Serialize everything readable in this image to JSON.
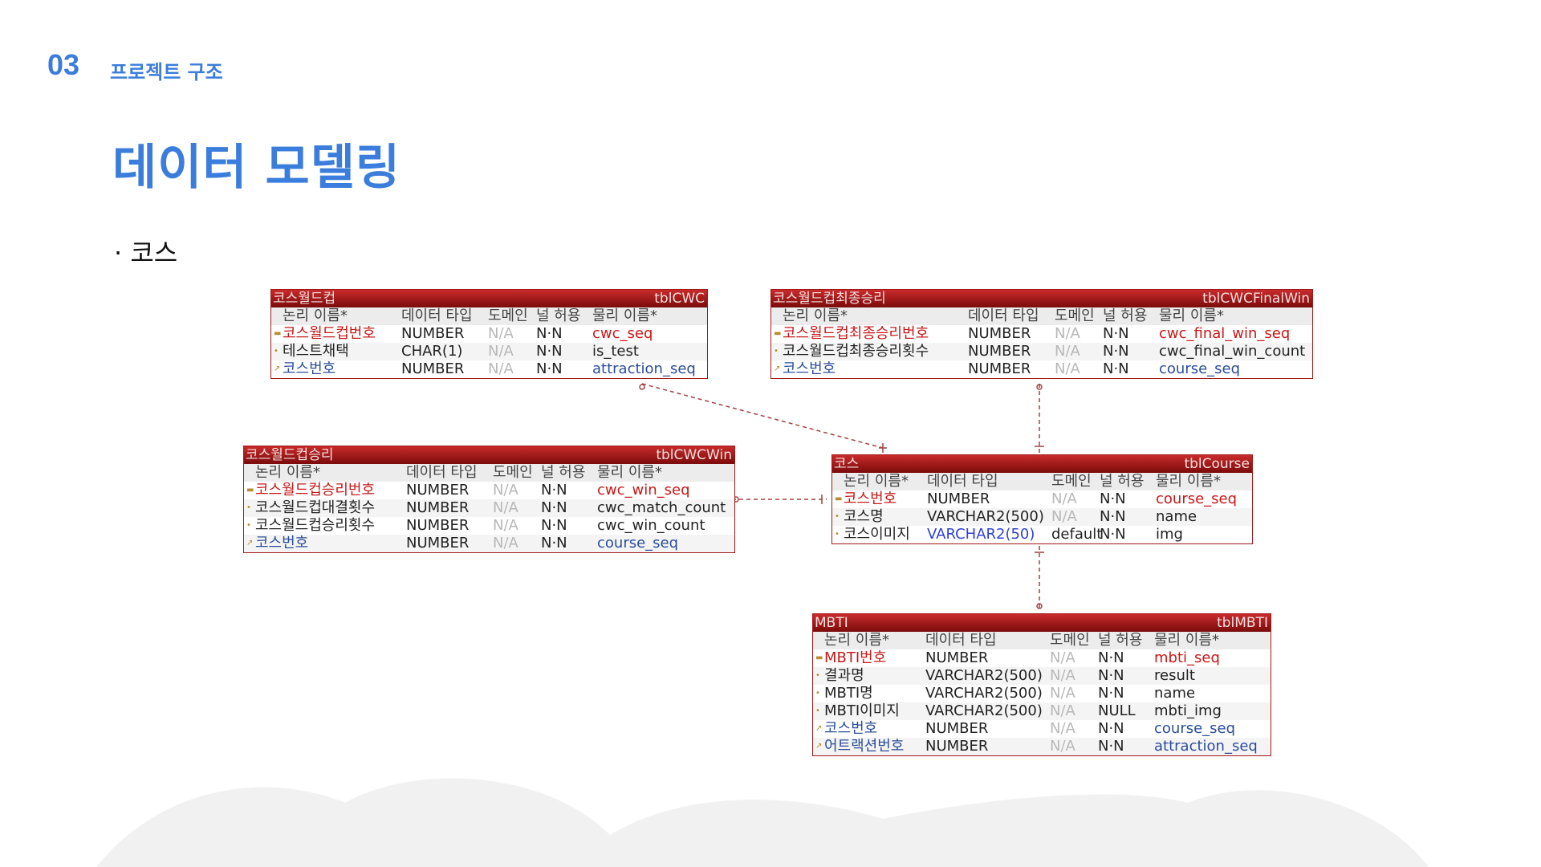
{
  "header": {
    "number": "03",
    "subtitle": "프로젝트 구조"
  },
  "title": "데이터 모델링",
  "bullet": "· 코스",
  "columns": {
    "logical": "논리 이름*",
    "datatype": "데이터 타입",
    "domain": "도메인",
    "null": "널 허용",
    "physical": "물리 이름*"
  },
  "entities": {
    "cwc": {
      "logical_name": "코스월드컵",
      "physical_name": "tblCWC",
      "rows": [
        {
          "logical": "코스월드컵번호",
          "type": "NUMBER",
          "domain": "N/A",
          "null": "N·N",
          "physical": "cwc_seq",
          "key": "pk"
        },
        {
          "logical": "테스트채택",
          "type": "CHAR(1)",
          "domain": "N/A",
          "null": "N·N",
          "physical": "is_test",
          "key": ""
        },
        {
          "logical": "코스번호",
          "type": "NUMBER",
          "domain": "N/A",
          "null": "N·N",
          "physical": "attraction_seq",
          "key": "fk"
        }
      ]
    },
    "cwcfinal": {
      "logical_name": "코스월드컵최종승리",
      "physical_name": "tblCWCFinalWin",
      "rows": [
        {
          "logical": "코스월드컵최종승리번호",
          "type": "NUMBER",
          "domain": "N/A",
          "null": "N·N",
          "physical": "cwc_final_win_seq",
          "key": "pk"
        },
        {
          "logical": "코스월드컵최종승리횟수",
          "type": "NUMBER",
          "domain": "N/A",
          "null": "N·N",
          "physical": "cwc_final_win_count",
          "key": ""
        },
        {
          "logical": "코스번호",
          "type": "NUMBER",
          "domain": "N/A",
          "null": "N·N",
          "physical": "course_seq",
          "key": "fk"
        }
      ]
    },
    "cwcwin": {
      "logical_name": "코스월드컵승리",
      "physical_name": "tblCWCWin",
      "rows": [
        {
          "logical": "코스월드컵승리번호",
          "type": "NUMBER",
          "domain": "N/A",
          "null": "N·N",
          "physical": "cwc_win_seq",
          "key": "pk"
        },
        {
          "logical": "코스월드컵대결횟수",
          "type": "NUMBER",
          "domain": "N/A",
          "null": "N·N",
          "physical": "cwc_match_count",
          "key": ""
        },
        {
          "logical": "코스월드컵승리횟수",
          "type": "NUMBER",
          "domain": "N/A",
          "null": "N·N",
          "physical": "cwc_win_count",
          "key": ""
        },
        {
          "logical": "코스번호",
          "type": "NUMBER",
          "domain": "N/A",
          "null": "N·N",
          "physical": "course_seq",
          "key": "fk"
        }
      ]
    },
    "course": {
      "logical_name": "코스",
      "physical_name": "tblCourse",
      "rows": [
        {
          "logical": "코스번호",
          "type": "NUMBER",
          "domain": "N/A",
          "null": "N·N",
          "physical": "course_seq",
          "key": "pk"
        },
        {
          "logical": "코스명",
          "type": "VARCHAR2(500)",
          "domain": "N/A",
          "null": "N·N",
          "physical": "name",
          "key": ""
        },
        {
          "logical": "코스이미지",
          "type": "VARCHAR2(50)",
          "domain": "default",
          "null": "N·N",
          "physical": "img",
          "key": "",
          "type_color": "blue"
        }
      ]
    },
    "mbti": {
      "logical_name": "MBTI",
      "physical_name": "tblMBTI",
      "rows": [
        {
          "logical": "MBTI번호",
          "type": "NUMBER",
          "domain": "N/A",
          "null": "N·N",
          "physical": "mbti_seq",
          "key": "pk"
        },
        {
          "logical": "결과명",
          "type": "VARCHAR2(500)",
          "domain": "N/A",
          "null": "N·N",
          "physical": "result",
          "key": ""
        },
        {
          "logical": "MBTI명",
          "type": "VARCHAR2(500)",
          "domain": "N/A",
          "null": "N·N",
          "physical": "name",
          "key": ""
        },
        {
          "logical": "MBTI이미지",
          "type": "VARCHAR2(500)",
          "domain": "N/A",
          "null": "NULL",
          "physical": "mbti_img",
          "key": ""
        },
        {
          "logical": "코스번호",
          "type": "NUMBER",
          "domain": "N/A",
          "null": "N·N",
          "physical": "course_seq",
          "key": "fk"
        },
        {
          "logical": "어트랙션번호",
          "type": "NUMBER",
          "domain": "N/A",
          "null": "N·N",
          "physical": "attraction_seq",
          "key": "fk"
        }
      ]
    }
  },
  "colors": {
    "accent": "#3b7ddd",
    "entity_header": "#a31818",
    "pk": "#c81818",
    "fk": "#2b4d9b",
    "connector": "#a04040"
  }
}
